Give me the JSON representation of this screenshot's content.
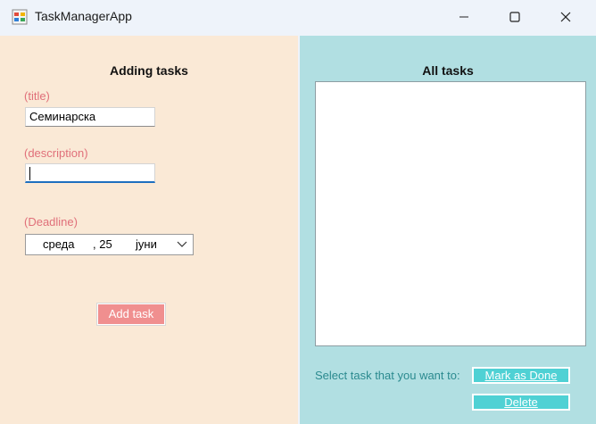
{
  "window": {
    "title": "TaskManagerApp",
    "icons": {
      "app": "app-icon",
      "minimize": "minimize-icon",
      "maximize": "maximize-icon",
      "close": "close-icon"
    }
  },
  "adding": {
    "heading": "Adding tasks",
    "title_label": "(title)",
    "title_value": "Семинарска",
    "description_label": "(description)",
    "description_value": "",
    "deadline_label": "(Deadline)",
    "deadline": {
      "weekday": "среда",
      "day": ", 25",
      "month": "јуни"
    },
    "add_button": "Add task"
  },
  "all_tasks": {
    "heading": "All tasks",
    "items": [],
    "prompt": "Select task that you want to:",
    "mark_done_button": "Mark as Done",
    "delete_button": "Delete"
  },
  "colors": {
    "left_bg": "#fae9d6",
    "right_bg": "#b1dfe2",
    "label_pink": "#e0707a",
    "add_button": "#f08f8f",
    "teal_button": "#4fd1d4",
    "prompt_text": "#2b8a8f"
  }
}
